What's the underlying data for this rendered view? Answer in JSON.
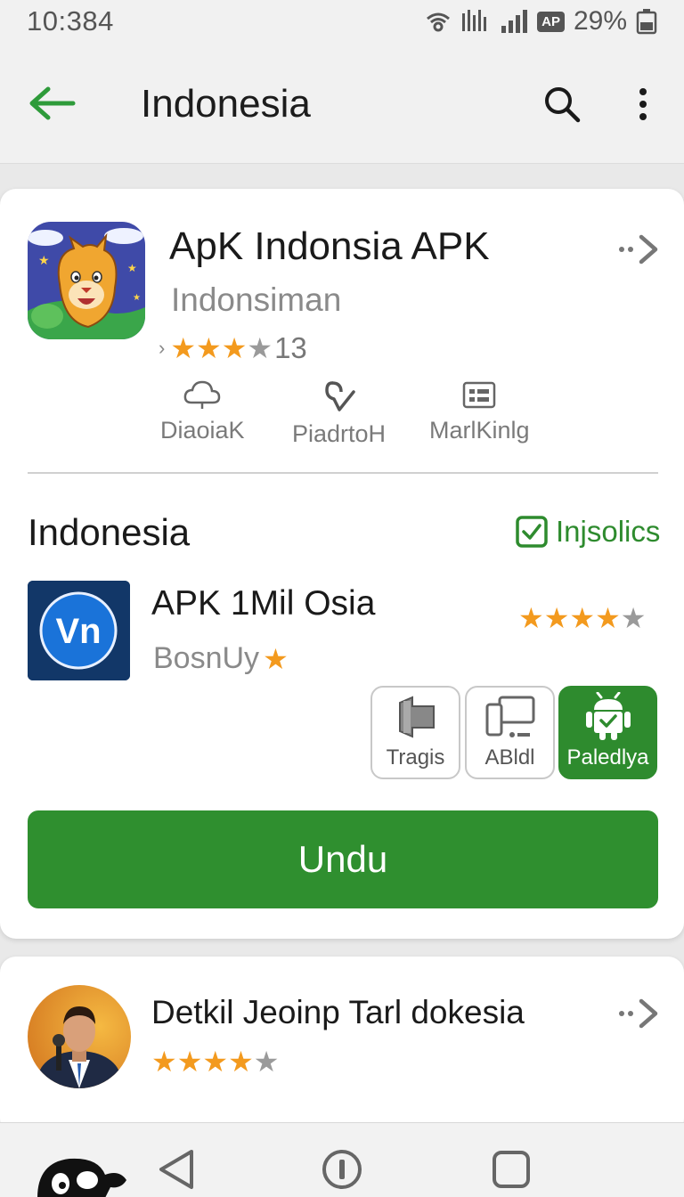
{
  "status": {
    "time": "10:384",
    "ap_badge": "AP",
    "battery": "29%"
  },
  "appbar": {
    "title": "Indonesia",
    "back_icon": "arrow-left-icon",
    "search_icon": "search-icon",
    "more_icon": "more-vert-icon",
    "accent": "#2e9b3a"
  },
  "featured_app": {
    "title": "ApK Indonsia APK",
    "developer": "Indonsiman",
    "rating_stars": 3,
    "rating_count": "13",
    "actions": [
      {
        "label": "DiaoiaK",
        "icon": "cloud-icon"
      },
      {
        "label": "PiadrtoH",
        "icon": "pin-check-icon"
      },
      {
        "label": "MarlKinlg",
        "icon": "calendar-icon"
      }
    ]
  },
  "section": {
    "title": "Indonesia",
    "verified_label": "Injsolics",
    "app": {
      "title": "APK 1Mil Osia",
      "developer": "BosnUy",
      "icon_text": "Vn",
      "rating_stars": 4
    },
    "chips": [
      {
        "label": "Tragis",
        "icon": "tag-icon"
      },
      {
        "label": "ABldl",
        "icon": "devices-icon"
      },
      {
        "label": "Paledlya",
        "icon": "android-icon"
      }
    ],
    "download_label": "Undu"
  },
  "second_card": {
    "title": "Detkil Jeoinp Tarl dokesia",
    "rating_stars": 4
  },
  "colors": {
    "green": "#2f8f2f",
    "star": "#f39a1e",
    "star_off": "#9a9a9a"
  }
}
